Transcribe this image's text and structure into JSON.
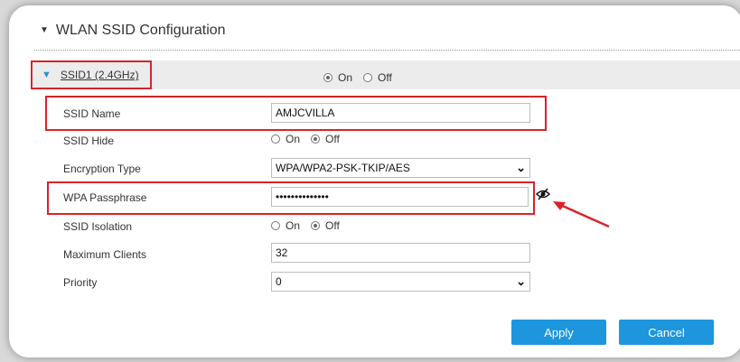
{
  "section": {
    "title": "WLAN SSID Configuration"
  },
  "ssid": {
    "header_label": "SSID1 (2.4GHz)",
    "status": {
      "on_label": "On",
      "off_label": "Off",
      "selected": "On"
    }
  },
  "form": {
    "ssid_name": {
      "label": "SSID Name",
      "value": "AMJCVILLA"
    },
    "ssid_hide": {
      "label": "SSID Hide",
      "on_label": "On",
      "off_label": "Off",
      "selected": "Off"
    },
    "encryption": {
      "label": "Encryption Type",
      "value": "WPA/WPA2-PSK-TKIP/AES"
    },
    "passphrase": {
      "label": "WPA Passphrase",
      "value": "••••••••••••••"
    },
    "isolation": {
      "label": "SSID Isolation",
      "on_label": "On",
      "off_label": "Off",
      "selected": "Off"
    },
    "max_clients": {
      "label": "Maximum Clients",
      "value": "32"
    },
    "priority": {
      "label": "Priority",
      "value": "0"
    }
  },
  "buttons": {
    "apply": "Apply",
    "cancel": "Cancel"
  },
  "colors": {
    "accent": "#1d96dd",
    "highlight": "#d9232a",
    "header_bg": "#ececec"
  },
  "icons": {
    "show_password": "eye-slash-icon",
    "collapse": "triangle-down-icon"
  }
}
